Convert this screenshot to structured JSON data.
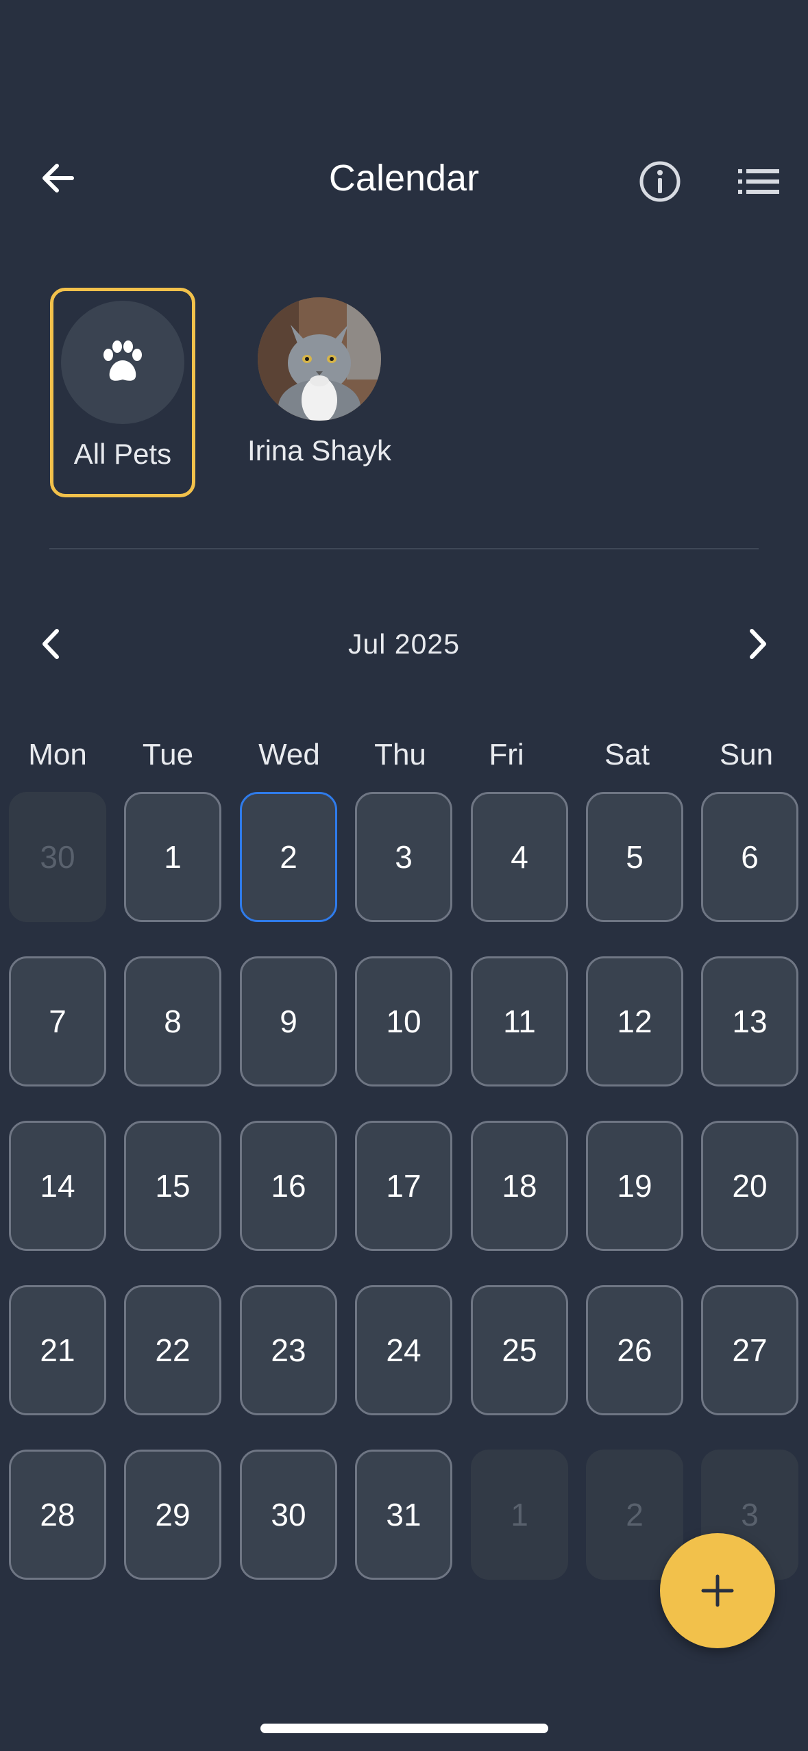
{
  "header": {
    "title": "Calendar",
    "back_icon": "arrow-left-icon",
    "info_icon": "info-circle-icon",
    "list_icon": "list-icon"
  },
  "pets": [
    {
      "label": "All Pets",
      "selected": true,
      "icon": "paw-icon"
    },
    {
      "label": "Irina Shayk",
      "selected": false,
      "icon": "cat-photo"
    }
  ],
  "month_nav": {
    "label": "Jul 2025",
    "prev_icon": "chevron-left-icon",
    "next_icon": "chevron-right-icon"
  },
  "weekdays": [
    "Mon",
    "Tue",
    "Wed",
    "Thu",
    "Fri",
    "Sat",
    "Sun"
  ],
  "weeks": [
    [
      {
        "d": "30",
        "outside": true
      },
      {
        "d": "1"
      },
      {
        "d": "2",
        "today": true
      },
      {
        "d": "3"
      },
      {
        "d": "4"
      },
      {
        "d": "5"
      },
      {
        "d": "6"
      }
    ],
    [
      {
        "d": "7"
      },
      {
        "d": "8"
      },
      {
        "d": "9"
      },
      {
        "d": "10"
      },
      {
        "d": "11"
      },
      {
        "d": "12"
      },
      {
        "d": "13"
      }
    ],
    [
      {
        "d": "14"
      },
      {
        "d": "15"
      },
      {
        "d": "16"
      },
      {
        "d": "17"
      },
      {
        "d": "18"
      },
      {
        "d": "19"
      },
      {
        "d": "20"
      }
    ],
    [
      {
        "d": "21"
      },
      {
        "d": "22"
      },
      {
        "d": "23"
      },
      {
        "d": "24"
      },
      {
        "d": "25"
      },
      {
        "d": "26"
      },
      {
        "d": "27"
      }
    ],
    [
      {
        "d": "28"
      },
      {
        "d": "29"
      },
      {
        "d": "30"
      },
      {
        "d": "31"
      },
      {
        "d": "1",
        "outside": true
      },
      {
        "d": "2",
        "outside": true
      },
      {
        "d": "3",
        "outside": true
      }
    ]
  ],
  "fab": {
    "icon": "plus-icon"
  },
  "colors": {
    "background": "#283040",
    "accent": "#F2C14B",
    "today_border": "#2F7BEA",
    "cell_bg": "#39424f"
  }
}
